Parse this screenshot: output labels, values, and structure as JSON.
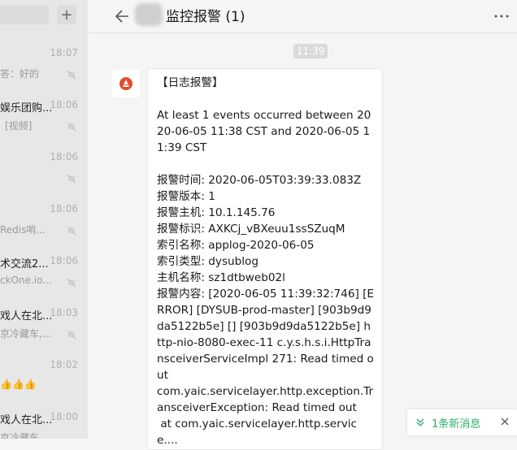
{
  "sidebar": {
    "conversations": [
      {
        "name": "",
        "time": "18:07",
        "preview": "答：好的"
      },
      {
        "name": "娱乐团购...",
        "time": "18:06",
        "preview": "[视频]"
      },
      {
        "name": "",
        "time": "18:06",
        "preview": ""
      },
      {
        "name": "",
        "time": "18:06",
        "preview": "Redis哨..."
      },
      {
        "name": "术交流2...",
        "time": "18:06",
        "preview": "ckOne.io..."
      },
      {
        "name": "戏人在北...",
        "time": "18:03",
        "preview": "京冷藏车,..."
      },
      {
        "name": "",
        "time": "18:02",
        "preview": "👍👍👍"
      },
      {
        "name": "戏人在北...",
        "time": "18:00",
        "preview": "京冷藏车"
      }
    ]
  },
  "header": {
    "title": "监控报警 (1)"
  },
  "chat": {
    "time_divider": "11:39",
    "message": "【日志报警】\n\nAt least 1 events occurred between 2020-06-05 11:38 CST and 2020-06-05 11:39 CST\n\n报警时间: 2020-06-05T03:39:33.083Z\n报警版本: 1\n报警主机: 10.1.145.76\n报警标识: AXKCj_vBXeuu1ssSZuqM\n索引名称: applog-2020-06-05\n索引类型: dysublog\n主机名称: sz1dtbweb02l\n报警内容: [2020-06-05 11:39:32:746] [ERROR] [DYSUB-prod-master] [903b9d9da5122b5e] [] [903b9d9da5122b5e] http-nio-8080-exec-11 c.y.s.h.s.i.HttpTransceiverServiceImpl 271: Read timed out\ncom.yaic.servicelayer.http.exception.TransceiverException: Read timed out\n at com.yaic.servicelayer.http.service...."
  },
  "new_message": {
    "label": "1条新消息"
  },
  "colors": {
    "accent": "#2aae67",
    "avatar": "#e04e2a"
  }
}
